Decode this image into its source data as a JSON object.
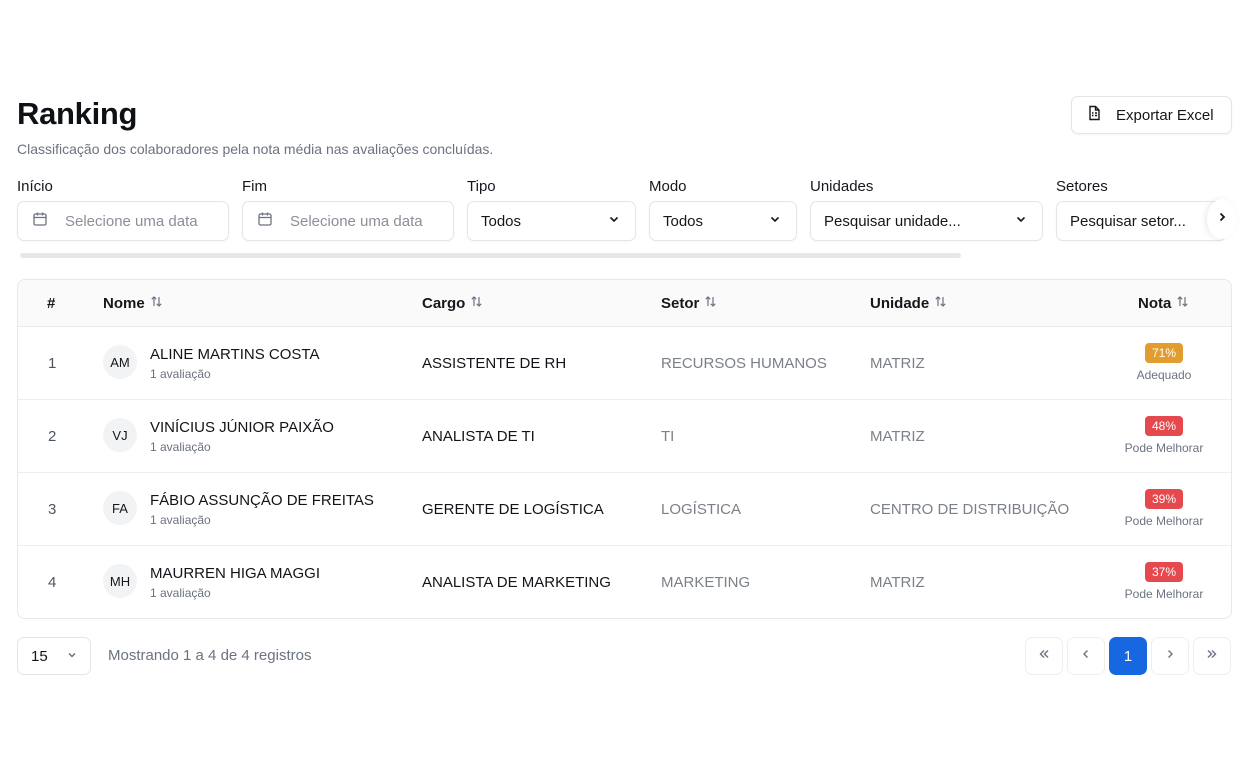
{
  "page": {
    "title": "Ranking",
    "subtitle": "Classificação dos colaboradores pela nota média nas avaliações concluídas.",
    "export_label": "Exportar Excel"
  },
  "filters": {
    "inicio": {
      "label": "Início",
      "placeholder": "Selecione uma data"
    },
    "fim": {
      "label": "Fim",
      "placeholder": "Selecione uma data"
    },
    "tipo": {
      "label": "Tipo",
      "value": "Todos"
    },
    "modo": {
      "label": "Modo",
      "value": "Todos"
    },
    "unidades": {
      "label": "Unidades",
      "placeholder": "Pesquisar unidade..."
    },
    "setores": {
      "label": "Setores",
      "placeholder": "Pesquisar setor..."
    }
  },
  "table": {
    "headers": {
      "num": "#",
      "nome": "Nome",
      "cargo": "Cargo",
      "setor": "Setor",
      "unidade": "Unidade",
      "nota": "Nota"
    },
    "rows": [
      {
        "num": "1",
        "initials": "AM",
        "name": "ALINE MARTINS COSTA",
        "evals": "1 avaliação",
        "cargo": "ASSISTENTE DE RH",
        "setor": "RECURSOS HUMANOS",
        "unidade": "MATRIZ",
        "score": "71%",
        "score_label": "Adequado",
        "badge_color": "#e39d2f"
      },
      {
        "num": "2",
        "initials": "VJ",
        "name": "VINÍCIUS JÚNIOR PAIXÃO",
        "evals": "1 avaliação",
        "cargo": "ANALISTA DE TI",
        "setor": "TI",
        "unidade": "MATRIZ",
        "score": "48%",
        "score_label": "Pode Melhorar",
        "badge_color": "#e5484d"
      },
      {
        "num": "3",
        "initials": "FA",
        "name": "FÁBIO ASSUNÇÃO DE FREITAS",
        "evals": "1 avaliação",
        "cargo": "GERENTE DE LOGÍSTICA",
        "setor": "LOGÍSTICA",
        "unidade": "CENTRO DE DISTRIBUIÇÃO",
        "score": "39%",
        "score_label": "Pode Melhorar",
        "badge_color": "#e5484d"
      },
      {
        "num": "4",
        "initials": "MH",
        "name": "MAURREN HIGA MAGGI",
        "evals": "1 avaliação",
        "cargo": "ANALISTA DE MARKETING",
        "setor": "MARKETING",
        "unidade": "MATRIZ",
        "score": "37%",
        "score_label": "Pode Melhorar",
        "badge_color": "#e5484d"
      }
    ]
  },
  "pagination": {
    "page_size": "15",
    "showing": "Mostrando 1 a 4 de 4 registros",
    "current_page": "1"
  },
  "colors": {
    "accent": "#1768e0",
    "adequado": "#e39d2f",
    "pode_melhorar": "#e5484d"
  }
}
